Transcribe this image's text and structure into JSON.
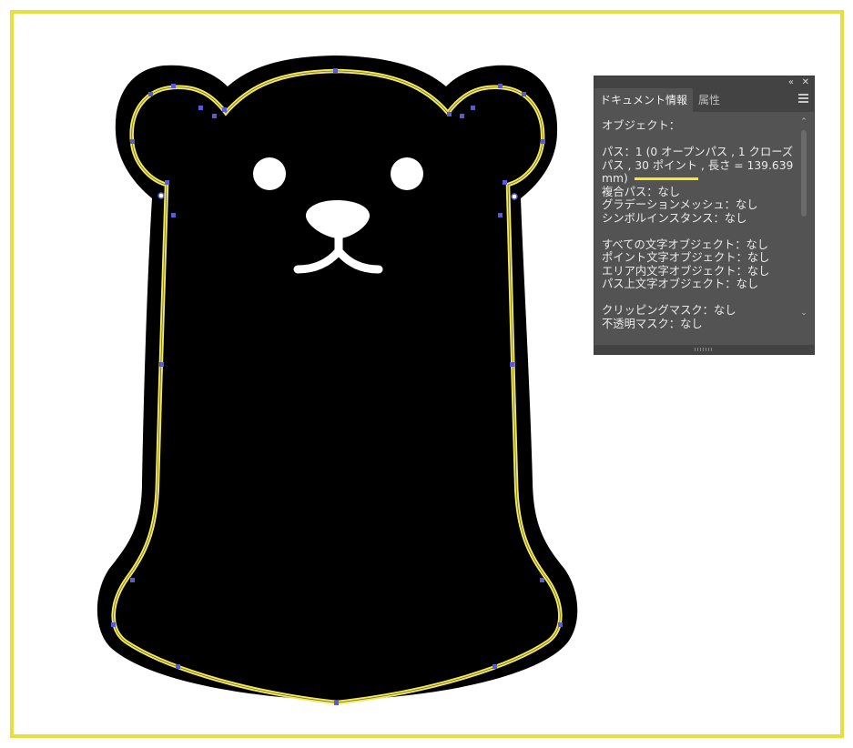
{
  "colors": {
    "frame": "#e8df3f",
    "bear": "#000000",
    "path_stroke": "#f3e95a",
    "anchor": "#5a5ad6",
    "panel_bg": "#535353",
    "highlight": "#f6e82b"
  },
  "panel": {
    "collapse_icon": "double-chevron-left-icon",
    "collapse_label": "«",
    "close_label": "✕",
    "tabs": [
      {
        "label": "ドキュメント情報",
        "active": true
      },
      {
        "label": "属性",
        "active": false
      }
    ],
    "menu_icon": "hamburger-menu-icon",
    "info": {
      "object_heading": "オブジェクト：",
      "path_line1": "パス：1 (0 オープンパス , 1 クローズ",
      "path_line2": "パス , 30 ポイント , 長さ = 139.639",
      "path_line3": "mm)",
      "compound_path": "複合パス：なし",
      "gradient_mesh": "グラデーションメッシュ：なし",
      "symbol_instance": "シンボルインスタンス：なし",
      "all_text": "すべての文字オブジェクト：なし",
      "point_text": "ポイント文字オブジェクト：なし",
      "area_text": "エリア内文字オブジェクト：なし",
      "path_text": "パス上文字オブジェクト：なし",
      "clipping_mask": "クリッピングマスク：なし",
      "opacity_mask": "不透明マスク：なし"
    },
    "scroll_up": "⌃",
    "scroll_down": "⌄"
  }
}
